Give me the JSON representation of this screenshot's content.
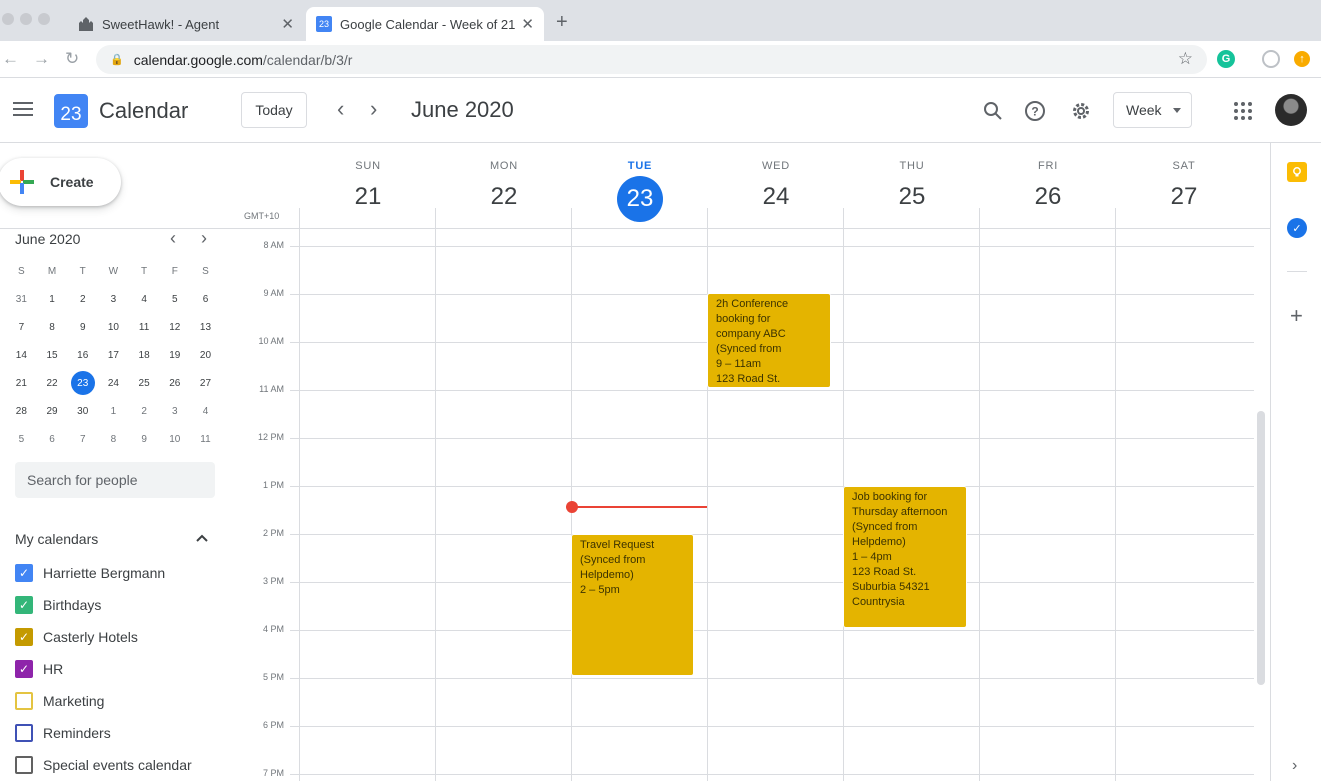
{
  "browser": {
    "tabs": [
      {
        "title": "SweetHawk! - Agent",
        "close": "✕"
      },
      {
        "title": "Google Calendar - Week of 21",
        "close": "✕",
        "favicon_text": "23"
      }
    ],
    "new_tab": "+",
    "url_host": "calendar.google.com",
    "url_path": "/calendar/b/3/r",
    "ext_grammarly": "G"
  },
  "header": {
    "app_name": "Calendar",
    "logo_day": "23",
    "today_label": "Today",
    "prev": "‹",
    "next": "›",
    "month_title": "June 2020",
    "view_label": "Week"
  },
  "sidebar": {
    "create_label": "Create",
    "mini_month": "June 2020",
    "dow": [
      "S",
      "M",
      "T",
      "W",
      "T",
      "F",
      "S"
    ],
    "weeks": [
      [
        "31",
        "1",
        "2",
        "3",
        "4",
        "5",
        "6"
      ],
      [
        "7",
        "8",
        "9",
        "10",
        "11",
        "12",
        "13"
      ],
      [
        "14",
        "15",
        "16",
        "17",
        "18",
        "19",
        "20"
      ],
      [
        "21",
        "22",
        "23",
        "24",
        "25",
        "26",
        "27"
      ],
      [
        "28",
        "29",
        "30",
        "1",
        "2",
        "3",
        "4"
      ],
      [
        "5",
        "6",
        "7",
        "8",
        "9",
        "10",
        "11"
      ]
    ],
    "search_placeholder": "Search for people",
    "my_calendars_label": "My calendars",
    "calendars": [
      {
        "name": "Harriette Bergmann",
        "color": "#4285f4",
        "checked": true
      },
      {
        "name": "Birthdays",
        "color": "#33b679",
        "checked": true
      },
      {
        "name": "Casterly Hotels",
        "color": "#c49a00",
        "checked": true
      },
      {
        "name": "HR",
        "color": "#8e24aa",
        "checked": true
      },
      {
        "name": "Marketing",
        "color": "#e4c441",
        "checked": false
      },
      {
        "name": "Reminders",
        "color": "#3f51b5",
        "checked": false
      },
      {
        "name": "Special events calendar",
        "color": "#616161",
        "checked": false
      }
    ]
  },
  "week": {
    "timezone": "GMT+10",
    "days": [
      {
        "dow": "SUN",
        "num": "21"
      },
      {
        "dow": "MON",
        "num": "22"
      },
      {
        "dow": "TUE",
        "num": "23",
        "today": true
      },
      {
        "dow": "WED",
        "num": "24"
      },
      {
        "dow": "THU",
        "num": "25"
      },
      {
        "dow": "FRI",
        "num": "26"
      },
      {
        "dow": "SAT",
        "num": "27"
      }
    ],
    "times": [
      "8 AM",
      "9 AM",
      "10 AM",
      "11 AM",
      "12 PM",
      "1 PM",
      "2 PM",
      "3 PM",
      "4 PM",
      "5 PM",
      "6 PM",
      "7 PM"
    ],
    "events": [
      {
        "lines": [
          "2h Conference",
          "booking for",
          "company ABC",
          "(Synced from",
          "9 – 11am",
          "123 Road St."
        ]
      },
      {
        "lines": [
          "Travel Request",
          "(Synced from",
          "Helpdemo)",
          "2 – 5pm"
        ]
      },
      {
        "lines": [
          "Job booking for",
          "Thursday afternoon",
          "(Synced from",
          "Helpdemo)",
          "1 – 4pm",
          "123 Road St.",
          "Suburbia 54321",
          "Countrysia"
        ]
      }
    ],
    "event_color": "#e4b400"
  }
}
